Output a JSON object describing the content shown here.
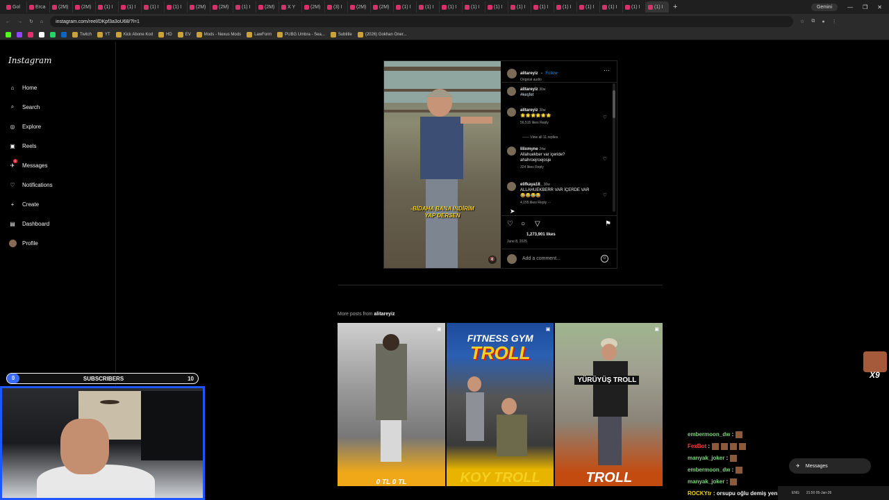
{
  "browser": {
    "tabs": [
      "Gol",
      "Erca",
      "(2M)",
      "(2M)",
      "(1) I",
      "(1) I",
      "(1) I",
      "(1) I",
      "(2M)",
      "(2M)",
      "(1) I",
      "(2M)",
      "X Y",
      "(2M)",
      "(3) I",
      "(2M)",
      "(2M)",
      "(1) I",
      "(1) I",
      "(1) I",
      "(1) I",
      "(1) I",
      "(1) I",
      "(1) I",
      "(1) I",
      "(1) I",
      "(1) I",
      "(1) I",
      "(1) I"
    ],
    "gemini": "Gemini",
    "url": "instagram.com/reel/DKpf3a3oU68/?l=1",
    "bookmarks": [
      "Twitch",
      "YT",
      "Kick Abone Kod",
      "HD",
      "EV",
      "Mods - Nexus Mods",
      "LawForm",
      "PUBG Umbra - Sea...",
      "Subtitle",
      "(2026) Gokhan Oner..."
    ]
  },
  "sidebar": {
    "logo": "Instagram",
    "items": [
      {
        "label": "Home"
      },
      {
        "label": "Search"
      },
      {
        "label": "Explore"
      },
      {
        "label": "Reels"
      },
      {
        "label": "Messages",
        "badge": "1"
      },
      {
        "label": "Notifications"
      },
      {
        "label": "Create"
      },
      {
        "label": "Dashboard"
      },
      {
        "label": "Profile"
      }
    ]
  },
  "post": {
    "image_caption_line1": "-BİDAHA BANA İNDİRİM",
    "image_caption_line2": "YAP DERSEN",
    "author": "alitareyiz",
    "follow": "Follow",
    "audio": "Original audio",
    "caption_user": "alitareyiz",
    "caption_time": "30w",
    "caption_tag": "#keşfet",
    "comments": [
      {
        "user": "alitareyiz",
        "time": "30w",
        "text": "🌟🌟🌟🌟🌟🌟",
        "likes": "56,515 likes",
        "reply": "Reply"
      },
      {
        "user": "lilixmyne",
        "time": "24w",
        "text": "Allahuekber var içeride? ahahroejroejosje",
        "likes": "324 likes",
        "reply": "Reply"
      },
      {
        "user": "elifkaya18_",
        "time": "30w",
        "text": "ALLAHUEKBERR VAR İÇERDE VAR 😂😂😂😂",
        "likes": "4,155 likes",
        "reply": "Reply"
      }
    ],
    "view_replies": "View all 11 replies",
    "likes": "1,273,901 likes",
    "date": "June 8, 2025",
    "add_comment_placeholder": "Add a comment..."
  },
  "more_posts": {
    "prefix": "More posts from",
    "author": "alitareyiz",
    "items": [
      {
        "top": "",
        "bottom": "0 TL   0 TL"
      },
      {
        "top1": "FITNESS GYM",
        "top2": "TROLL",
        "bottom": "KOY TROLL"
      },
      {
        "label": "YÜRÜYÜŞ TROLL",
        "bottom": "TROLL"
      }
    ]
  },
  "overlay": {
    "subscribers_label": "SUBSCRIBERS",
    "subscribers_current": "0",
    "subscribers_goal": "10",
    "emote_multiplier": "X9",
    "chat": [
      {
        "user": "embermoon_dw",
        "text": ":"
      },
      {
        "user": "FexBot",
        "text": ":"
      },
      {
        "user": "manyak_joker",
        "text": ":"
      },
      {
        "user": "embermoon_dw",
        "text": ":"
      },
      {
        "user": "manyak_joker",
        "text": ":"
      },
      {
        "user": "ROCKYtr",
        "text": ": orsupu oğlu demiş yeni mi bu"
      }
    ],
    "messages_button": "Messages",
    "taskbar_lang": "ENG",
    "taskbar_time": "21:50",
    "taskbar_date": "05-Jan-26"
  }
}
